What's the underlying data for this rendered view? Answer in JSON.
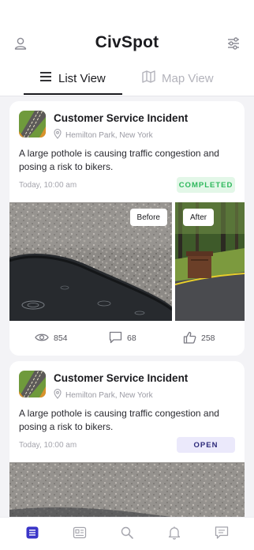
{
  "header": {
    "app_title": "CivSpot",
    "left_icon": "user-icon",
    "right_icon": "filter-sliders-icon"
  },
  "tabs": [
    {
      "label": "List View",
      "icon": "list-icon",
      "active": true
    },
    {
      "label": "Map View",
      "icon": "map-icon",
      "active": false
    }
  ],
  "posts": [
    {
      "title": "Customer Service Incident",
      "location": "Hemilton Park, New York",
      "description": "A large pothole is causing traffic congestion and posing a risk to bikers.",
      "time": "Today, 10:00 am",
      "status": "COMPLETED",
      "status_color": "#2eb85c",
      "before_label": "Before",
      "after_label": "After",
      "views": "854",
      "comments": "68",
      "likes": "258"
    },
    {
      "title": "Customer Service Incident",
      "location": "Hemilton Park, New York",
      "description": "A large pothole is causing traffic congestion and posing a risk to bikers.",
      "time": "Today, 10:00 am",
      "status": "OPEN",
      "status_color": "#2d2a7a"
    }
  ],
  "bottom_nav": [
    {
      "icon": "feed-icon",
      "active": true
    },
    {
      "icon": "news-icon",
      "active": false
    },
    {
      "icon": "search-icon",
      "active": false
    },
    {
      "icon": "bell-icon",
      "active": false
    },
    {
      "icon": "message-icon",
      "active": false
    }
  ],
  "colors": {
    "accent": "#3b36c8",
    "completed": "#2eb85c",
    "open": "#2d2a7a",
    "inactive_icon": "#b3b3bb"
  }
}
